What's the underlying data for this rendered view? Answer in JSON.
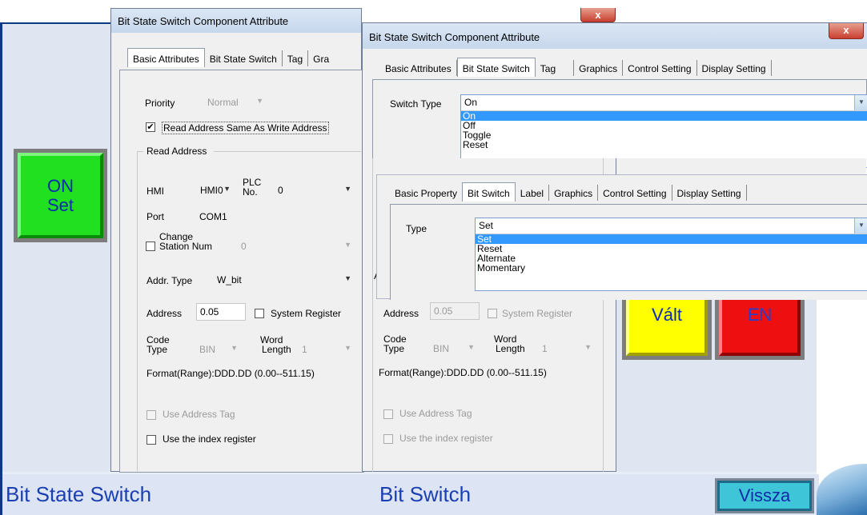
{
  "footer": {
    "left_title": "Bit State Switch",
    "right_title": "Bit Switch",
    "back_button": "Vissza"
  },
  "buttons": {
    "on_set_line1": "ON",
    "on_set_line2": "Set",
    "valt": "Vált",
    "en": "EN"
  },
  "win1": {
    "title": "Bit State Switch Component Attribute",
    "tabs": [
      "Basic Attributes",
      "Bit State Switch",
      "Tag",
      "Gra"
    ],
    "priority_label": "Priority",
    "priority_value": "Normal",
    "read_same_label": "Read Address Same As Write Address",
    "read_address_group": "Read Address",
    "hmi_label": "HMI",
    "hmi_value": "HMI0",
    "plc_label_1": "PLC",
    "plc_label_2": "No.",
    "plc_value": "0",
    "port_label": "Port",
    "port_value": "COM1",
    "change_station_1": "Change",
    "change_station_2": "Station Num",
    "station_value": "0",
    "addr_type_label": "Addr. Type",
    "addr_type_value": "W_bit",
    "address_label": "Address",
    "address_value": "0.05",
    "system_register_label": "System Register",
    "code_type_1": "Code",
    "code_type_2": "Type",
    "code_type_value": "BIN",
    "word_length_1": "Word",
    "word_length_2": "Length",
    "word_length_value": "1",
    "format_range": "Format(Range):DDD.DD (0.00--511.15)",
    "use_address_tag": "Use Address Tag",
    "use_index_register": "Use the index register"
  },
  "win2": {
    "title": "Bit State Switch Component Attribute",
    "close": "x",
    "tabs": [
      "Basic Attributes",
      "Bit State Switch",
      "Tag",
      "Graphics",
      "Control Setting",
      "Display Setting"
    ],
    "switch_type_label": "Switch Type",
    "switch_type_value": "On",
    "switch_type_options": [
      "On",
      "Off",
      "Toggle",
      "Reset"
    ],
    "sub_tabs": [
      "Basic Property",
      "Bit Switch",
      "Label",
      "Graphics",
      "Control Setting",
      "Display Setting"
    ],
    "type_label": "Type",
    "type_value": "Set",
    "type_options": [
      "Set",
      "Reset",
      "Alternate",
      "Momentary"
    ],
    "a_label": "A",
    "address_label": "Address",
    "address_value": "0.05",
    "system_register_label": "System Register",
    "code_type_1": "Code",
    "code_type_2": "Type",
    "code_type_value": "BIN",
    "word_length_1": "Word",
    "word_length_2": "Length",
    "word_length_value": "1",
    "format_range": "Format(Range):DDD.DD (0.00--511.15)",
    "use_address_tag": "Use Address Tag",
    "use_index_register": "Use the index register"
  },
  "colors": {
    "footer_text": "#1a3fb0",
    "on_button": "#20e020",
    "valt_button": "#ffff00",
    "en_button": "#ee1010",
    "highlight": "#3399ff"
  }
}
